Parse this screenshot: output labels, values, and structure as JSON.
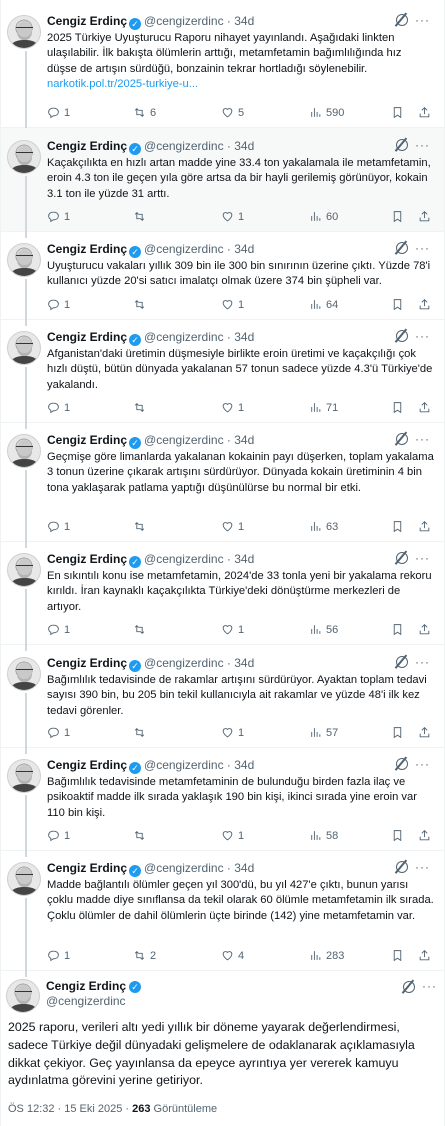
{
  "author": {
    "name": "Cengiz Erdinç",
    "handle": "@cengizerdinc",
    "handle_time": "@cengizerdinc · 34d"
  },
  "tweets": [
    {
      "text": "2025 Türkiye Uyuşturucu Raporu nihayet yayınlandı. Aşağıdaki linkten ulaşılabilir. İlk bakışta ölümlerin arttığı, metamfetamin bağımlılığında hız düşse de artışın sürdüğü, bonzainin tekrar hortladığı söylenebilir.",
      "link": "narkotik.pol.tr/2025-turkiye-u...",
      "replies": "1",
      "reposts": "6",
      "likes": "5",
      "views": "590"
    },
    {
      "text": "Kaçakçılıkta en hızlı artan madde yine 33.4 ton yakalamala ile metamfetamin, eroin 4.3 ton ile geçen yıla göre artsa da bir hayli gerilemiş görünüyor, kokain 3.1 ton ile yüzde 31 arttı.",
      "replies": "1",
      "reposts": "",
      "likes": "1",
      "views": "60"
    },
    {
      "text": "Uyuşturucu vakaları yıllık 309 bin ile 300 bin sınırının üzerine çıktı. Yüzde 78'i kullanıcı yüzde 20'si satıcı imalatçı olmak üzere 374 bin şüpheli var.",
      "replies": "1",
      "reposts": "",
      "likes": "1",
      "views": "64"
    },
    {
      "text": "Afganistan'daki üretimin düşmesiyle birlikte eroin üretimi ve kaçakçılığı çok hızlı düştü, bütün dünyada yakalanan 57 tonun sadece yüzde 4.3'ü Türkiye'de yakalandı.",
      "replies": "1",
      "reposts": "",
      "likes": "1",
      "views": "71"
    },
    {
      "text": "Geçmişe göre limanlarda yakalanan kokainin payı düşerken, toplam yakalama 3 tonun üzerine çıkarak artışını sürdürüyor. Dünyada kokain üretiminin 4 bin tona yaklaşarak patlama yaptığı düşünülürse bu normal bir etki.",
      "replies": "1",
      "reposts": "",
      "likes": "1",
      "views": "63"
    },
    {
      "text": "En sıkıntılı konu ise metamfetamin, 2024'de 33 tonla yeni bir yakalama rekoru kırıldı. İran kaynaklı kaçakçılıkta Türkiye'deki dönüştürme merkezleri de artıyor.",
      "replies": "1",
      "reposts": "",
      "likes": "1",
      "views": "56"
    },
    {
      "text": "Bağımlılık tedavisinde de rakamlar artışını sürdürüyor. Ayaktan toplam tedavi sayısı 390 bin, bu 205 bin tekil kullanıcıyla ait rakamlar ve yüzde 48'i ilk kez tedavi görenler.",
      "replies": "1",
      "reposts": "",
      "likes": "1",
      "views": "57"
    },
    {
      "text": "Bağımlılık tedavisinde metamfetaminin de bulunduğu birden fazla ilaç ve psikoaktif madde ilk sırada yaklaşık 190 bin kişi, ikinci sırada yine eroin var 110 bin kişi.",
      "replies": "1",
      "reposts": "",
      "likes": "1",
      "views": "58"
    },
    {
      "text": "Madde bağlantılı ölümler geçen yıl 300'dü, bu yıl 427'e çıktı, bunun yarısı çoklu madde diye sınıflansa da tekil olarak 60 ölümle metamfetamin ilk sırada. Çoklu ölümler de dahil ölümlerin üçte birinde (142) yine metamfetamin var.",
      "replies": "1",
      "reposts": "2",
      "likes": "4",
      "views": "283"
    }
  ],
  "focus": {
    "text": "2025 raporu, verileri altı yedi yıllık bir döneme yayarak değerlendirmesi, sadece Türkiye değil dünyadaki gelişmelere de odaklanarak açıklamasıyla dikkat çekiyor. Geç yayınlansa da epeyce ayrıntıya yer vererek kamuyu aydınlatma görevini yerine getiriyor.",
    "time": "ÖS 12:32 · 15 Eki 2025 · ",
    "views_count": "263",
    "views_label": " Görüntüleme"
  },
  "more_label": "···",
  "icons": [
    "reply-icon",
    "repost-icon",
    "like-icon",
    "views-icon",
    "bookmark-icon",
    "share-icon",
    "grok-icon",
    "verified-badge-icon"
  ],
  "colors": {
    "accent": "#1d9bf0",
    "muted": "#536471",
    "text": "#0f1419",
    "selected_bg": "#f7f9f9"
  }
}
